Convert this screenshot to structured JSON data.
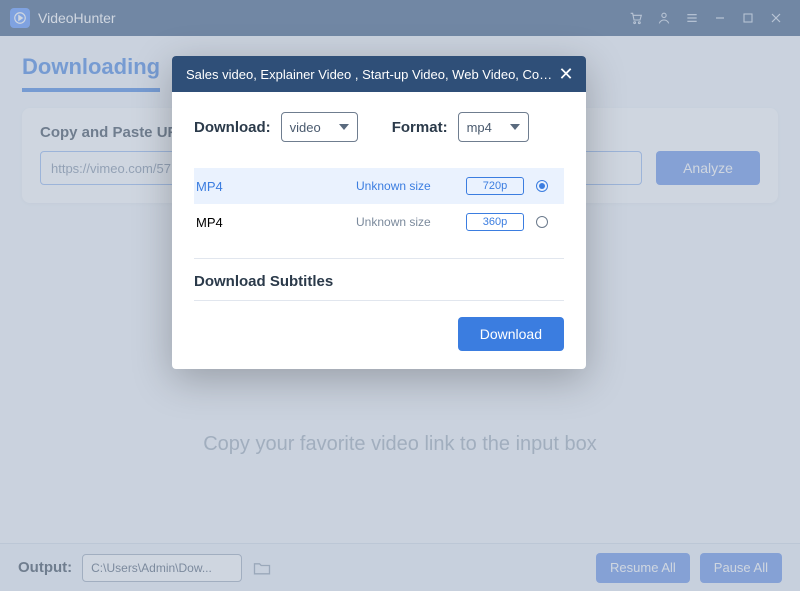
{
  "app": {
    "name": "VideoHunter"
  },
  "tabs": {
    "downloading": "Downloading"
  },
  "panel": {
    "label": "Copy and Paste URL",
    "url_value": "https://vimeo.com/57",
    "analyze": "Analyze"
  },
  "hint": "Copy your favorite video link to the input box",
  "bottom": {
    "output_label": "Output:",
    "output_path": "C:\\Users\\Admin\\Dow...",
    "resume": "Resume All",
    "pause": "Pause All"
  },
  "modal": {
    "title": "Sales video, Explainer Video , Start-up Video, Web Video, Comic ...",
    "download_label": "Download:",
    "download_value": "video",
    "format_label": "Format:",
    "format_value": "mp4",
    "options": [
      {
        "fmt": "MP4",
        "size": "Unknown size",
        "quality": "720p",
        "selected": true
      },
      {
        "fmt": "MP4",
        "size": "Unknown size",
        "quality": "360p",
        "selected": false
      }
    ],
    "subtitles_label": "Download Subtitles",
    "download_btn": "Download"
  }
}
